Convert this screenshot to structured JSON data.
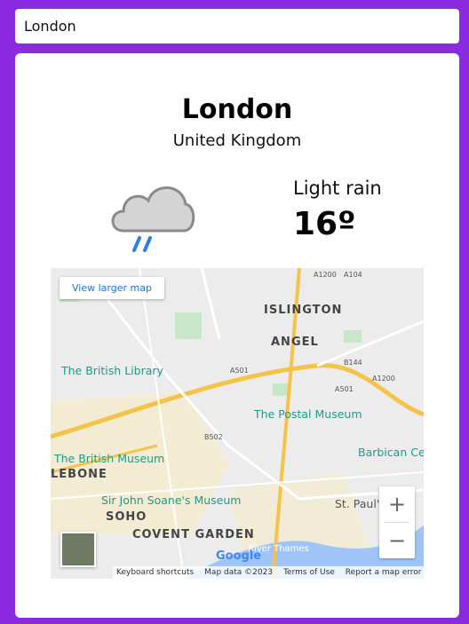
{
  "search": {
    "value": "London"
  },
  "weather": {
    "city": "London",
    "country": "United Kingdom",
    "description": "Light rain",
    "temperature": "16º",
    "icon": "rain-cloud-icon"
  },
  "map": {
    "view_larger": "View larger map",
    "areas": [
      "ISLINGTON",
      "ANGEL",
      "SOHO",
      "COVENT GARDEN",
      "LEBONE"
    ],
    "pois": [
      "The British Library",
      "The Postal Museum",
      "The British Museum",
      "Sir John Soane's Museum",
      "Barbican Ce",
      "St. Paul'",
      "River Thames"
    ],
    "roads": [
      "A501",
      "A501",
      "B502",
      "A1200",
      "A104",
      "B144",
      "A1200"
    ],
    "zoom_in": "+",
    "zoom_out": "−",
    "google": "Google",
    "attribution": [
      "Keyboard shortcuts",
      "Map data ©2023",
      "Terms of Use",
      "Report a map error"
    ]
  }
}
